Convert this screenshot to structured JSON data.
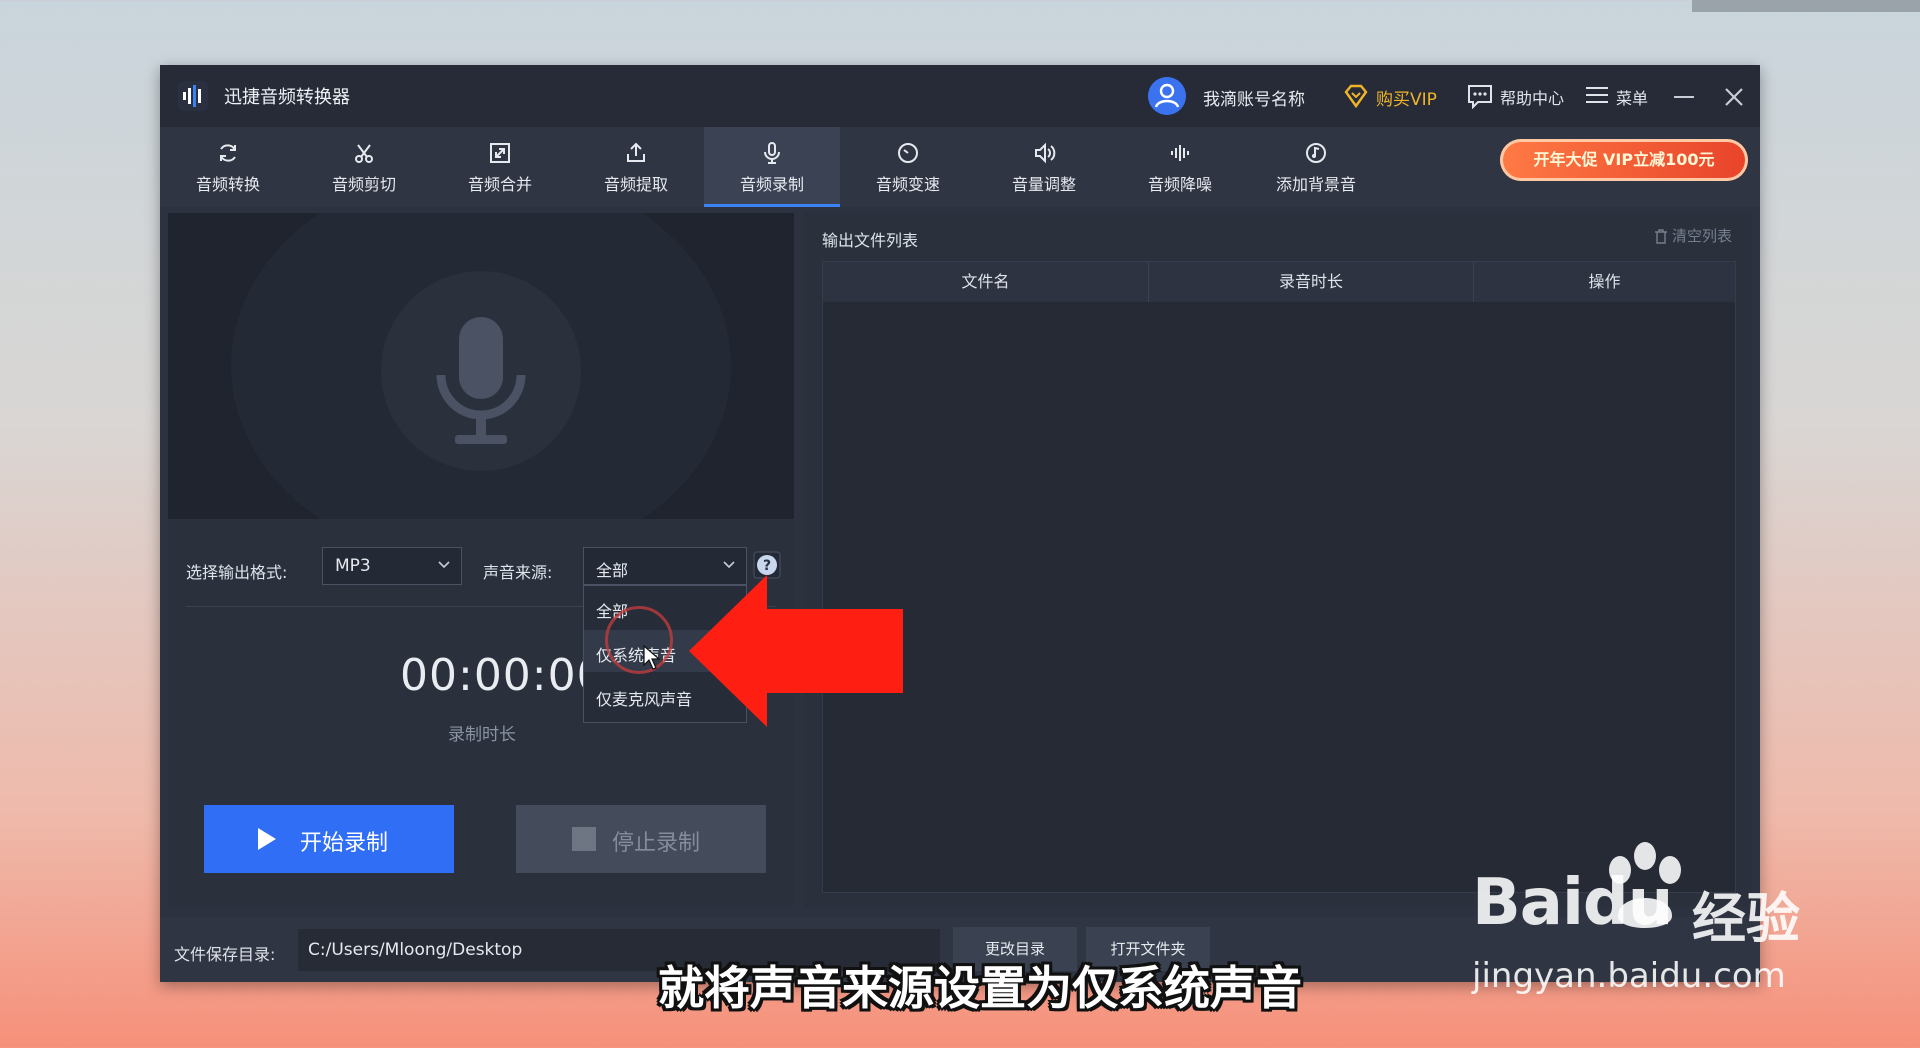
{
  "app": {
    "title": "迅捷音频转换器"
  },
  "header": {
    "user_name": "我滴账号名称",
    "vip_label": "购买VIP",
    "help_label": "帮助中心",
    "menu_label": "菜单"
  },
  "toolbar": {
    "items": [
      {
        "label": "音频转换",
        "icon": "refresh-icon"
      },
      {
        "label": "音频剪切",
        "icon": "scissors-icon"
      },
      {
        "label": "音频合并",
        "icon": "merge-icon"
      },
      {
        "label": "音频提取",
        "icon": "export-icon"
      },
      {
        "label": "音频录制",
        "icon": "microphone-icon",
        "active": true
      },
      {
        "label": "音频变速",
        "icon": "speed-icon"
      },
      {
        "label": "音量调整",
        "icon": "volume-icon"
      },
      {
        "label": "音频降噪",
        "icon": "waveform-icon"
      },
      {
        "label": "添加背景音",
        "icon": "music-note-icon"
      }
    ],
    "promo": "开年大促 VIP立减100元"
  },
  "recorder": {
    "format_label": "选择输出格式:",
    "format_value": "MP3",
    "source_label": "声音来源:",
    "source_value": "全部",
    "source_options": [
      "全部",
      "仅系统声音",
      "仅麦克风声音"
    ],
    "source_hovered": "仅系统声音",
    "timer": "00:00:00",
    "timer_label": "录制时长",
    "start_label": "开始录制",
    "stop_label": "停止录制"
  },
  "output": {
    "title": "输出文件列表",
    "clear_label": "清空列表",
    "columns": [
      "文件名",
      "录音时长",
      "操作"
    ]
  },
  "footer": {
    "save_label": "文件保存目录:",
    "path": "C:/Users/Mloong/Desktop",
    "change_label": "更改目录",
    "open_label": "打开文件夹"
  },
  "overlay": {
    "subtitle": "就将声音来源设置为仅系统声音",
    "watermark_main": "Baidu",
    "watermark_cn": "经验",
    "watermark_url": "jingyan.baidu.com"
  },
  "colors": {
    "accent": "#2f6ef5",
    "vip": "#f0b429",
    "arrow": "#ff1e12"
  }
}
